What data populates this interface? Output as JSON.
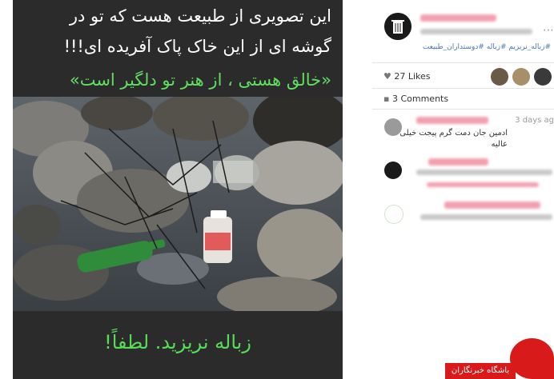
{
  "post": {
    "caption_line1": "این تصویری از طبیعت هست که تو در",
    "caption_line2": "گوشه ای از این خاک پاک آفریده ای!!!",
    "caption_line3": "«خالق هستی ، از هنر تو دلگیر است»",
    "bottom_text": "زباله نریزید. لطفاً!"
  },
  "sidebar": {
    "hashtags": "#زباله_نریزیم #زباله #دوستداران_طبیعت",
    "likes": "27 Likes",
    "comments_count": "3 Comments",
    "comment_time": "3 days ag",
    "comment1_line1": "ادمین جان دمت گرم پیجت خیلی",
    "comment1_line2": "عالیه"
  },
  "footer": {
    "badge": "باشگاه خبرنگاران"
  },
  "colors": {
    "caption_white": "#ffffff",
    "caption_green": "#5fe05f",
    "brand_red": "#d81a1a",
    "hashtag_blue": "#4a76b8"
  },
  "icons": [
    "trash-can-person-icon",
    "heart-icon",
    "comment-icon",
    "more-dots-icon"
  ]
}
